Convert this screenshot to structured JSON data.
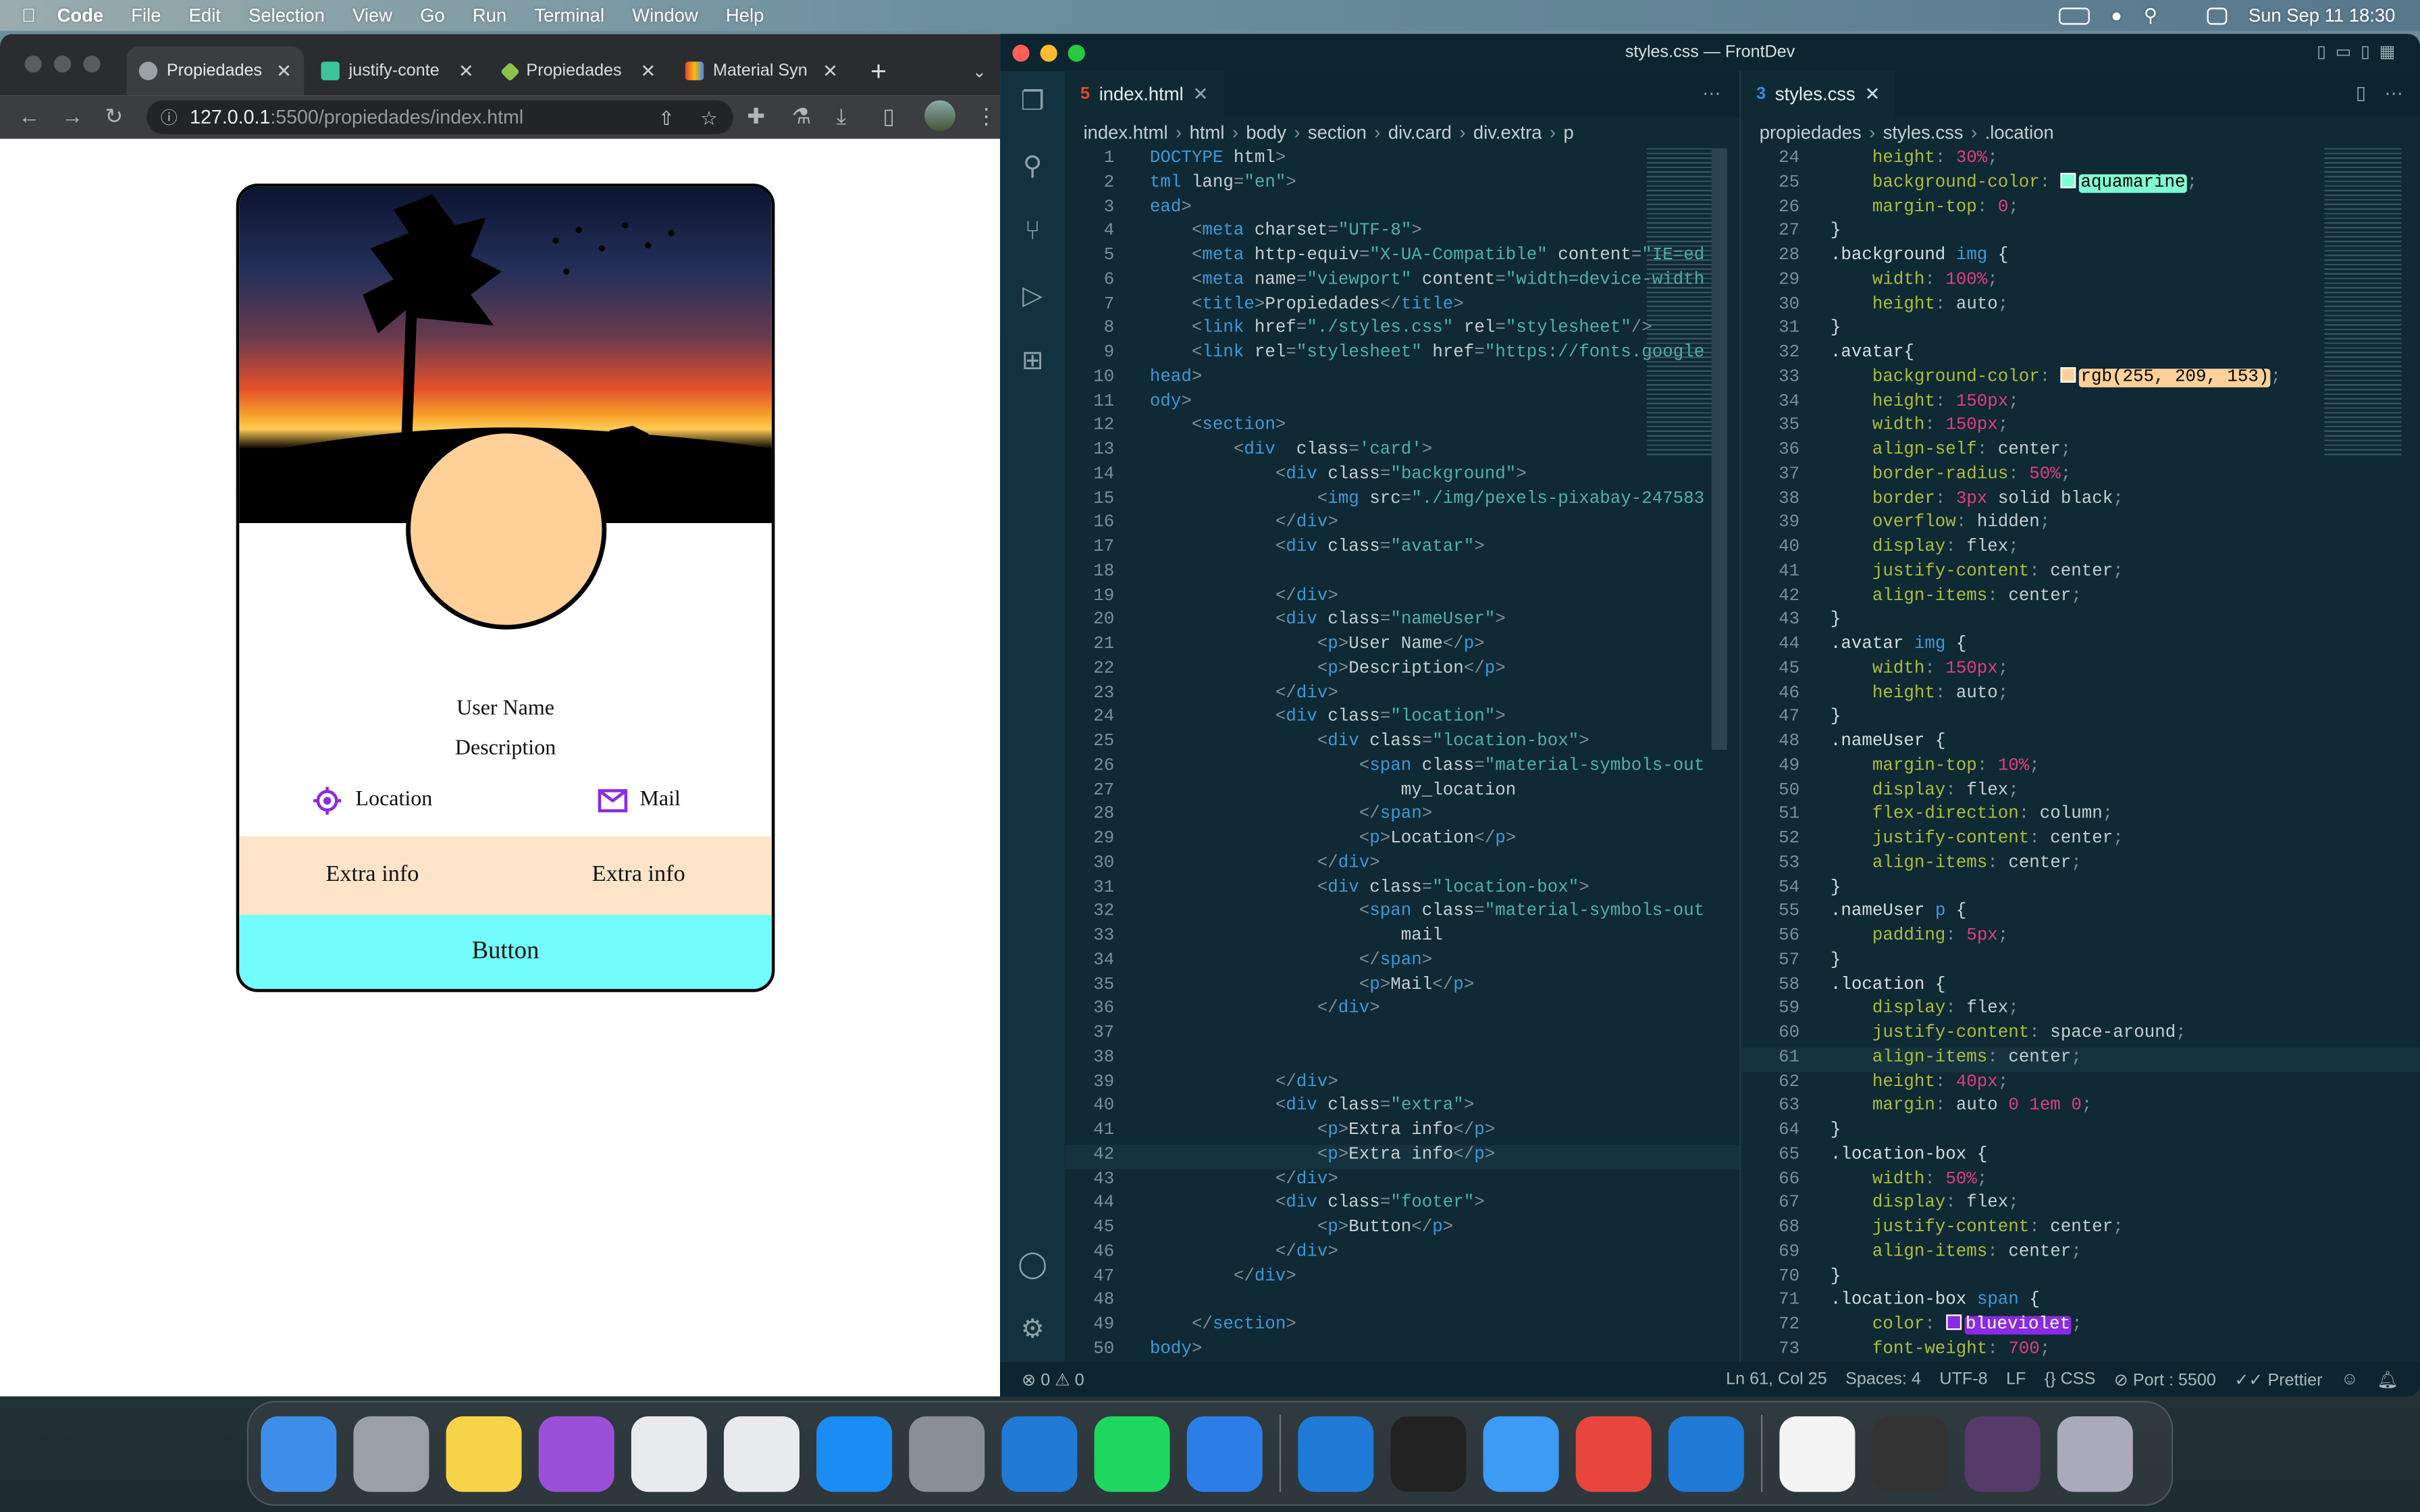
{
  "menubar": {
    "app": "Code",
    "items": [
      "File",
      "Edit",
      "Selection",
      "View",
      "Go",
      "Run",
      "Terminal",
      "Window",
      "Help"
    ],
    "clock": "Sun Sep 11  18:30"
  },
  "browser": {
    "tabs": [
      {
        "title": "Propiedades",
        "color": "#9aa0a6"
      },
      {
        "title": "justify-conte",
        "color": "#3cc49a"
      },
      {
        "title": "Propiedades",
        "color": "#8bc34a"
      },
      {
        "title": "Material Syn",
        "color": "#f4a81d"
      }
    ],
    "url_host": "127.0.0.1",
    "url_rest": ":5500/propiedades/index.html"
  },
  "card": {
    "user_name": "User Name",
    "description": "Description",
    "location_label": "Location",
    "mail_label": "Mail",
    "extra": [
      "Extra info",
      "Extra info"
    ],
    "button": "Button",
    "accent": "#8a2be2"
  },
  "vscode": {
    "title": "styles.css — FrontDev",
    "left_tab": "index.html",
    "right_tab": "styles.css",
    "left_crumbs": [
      "index.html",
      "html",
      "body",
      "section",
      "div.card",
      "div.extra",
      "p"
    ],
    "right_crumbs": [
      "propiedades",
      "styles.css",
      ".location"
    ],
    "html_start": 1,
    "html_lines": [
      "DOCTYPE html>",
      "tml lang=\"en\">",
      "ead>",
      "    <meta charset=\"UTF-8\">",
      "    <meta http-equiv=\"X-UA-Compatible\" content=\"IE=ed",
      "    <meta name=\"viewport\" content=\"width=device-width",
      "    <title>Propiedades</title>",
      "    <link href=\"./styles.css\" rel=\"stylesheet\"/>",
      "    <link rel=\"stylesheet\" href=\"https://fonts.google",
      "head>",
      "ody>",
      "    <section>",
      "        <div  class='card'>",
      "            <div class=\"background\">",
      "                <img src=\"./img/pexels-pixabay-247583",
      "            </div>",
      "            <div class=\"avatar\">",
      "",
      "            </div>",
      "            <div class=\"nameUser\">",
      "                <p>User Name</p>",
      "                <p>Description</p>",
      "            </div>",
      "            <div class=\"location\">",
      "                <div class=\"location-box\">",
      "                    <span class=\"material-symbols-out",
      "                        my_location",
      "                    </span>",
      "                    <p>Location</p>",
      "                </div>",
      "                <div class=\"location-box\">",
      "                    <span class=\"material-symbols-out",
      "                        mail",
      "                    </span>",
      "                    <p>Mail</p>",
      "                </div>",
      "",
      "",
      "            </div>",
      "            <div class=\"extra\">",
      "                <p>Extra info</p>",
      "                <p>Extra info</p>",
      "            </div>",
      "            <div class=\"footer\">",
      "                <p>Button</p>",
      "            </div>",
      "        </div>",
      "",
      "    </section>",
      "body>"
    ],
    "html_current": 42,
    "css_start": 24,
    "css_lines": [
      "    height: 30%;",
      "    background-color: aquamarine;",
      "    margin-top: 0;",
      "}",
      ".background img {",
      "    width: 100%;",
      "    height: auto;",
      "}",
      ".avatar{",
      "    background-color: rgb(255, 209, 153);",
      "    height: 150px;",
      "    width: 150px;",
      "    align-self: center;",
      "    border-radius: 50%;",
      "    border: 3px solid black;",
      "    overflow: hidden;",
      "    display: flex;",
      "    justify-content: center;",
      "    align-items: center;",
      "}",
      ".avatar img {",
      "    width: 150px;",
      "    height: auto;",
      "}",
      ".nameUser {",
      "    margin-top: 10%;",
      "    display: flex;",
      "    flex-direction: column;",
      "    justify-content: center;",
      "    align-items: center;",
      "}",
      ".nameUser p {",
      "    padding: 5px;",
      "}",
      ".location {",
      "    display: flex;",
      "    justify-content: space-around;",
      "    align-items: center;",
      "    height: 40px;",
      "    margin: auto 0 1em 0;",
      "}",
      ".location-box {",
      "    width: 50%;",
      "    display: flex;",
      "    justify-content: center;",
      "    align-items: center;",
      "}",
      ".location-box span {",
      "    color: blueviolet;",
      "    font-weight: 700;"
    ],
    "css_current": 61,
    "swatches": {
      "aquamarine": "#7fffd4",
      "rgb(255, 209, 153)": "#ffd199",
      "black": "#000000",
      "blueviolet": "#8a2be2"
    },
    "status": {
      "problems": "0",
      "warnings": "0",
      "position": "Ln 61, Col 25",
      "spaces": "Spaces: 4",
      "encoding": "UTF-8",
      "eol": "LF",
      "language": "CSS",
      "port": "Port : 5500",
      "formatter": "Prettier"
    }
  },
  "dock": [
    "finder-icon",
    "launchpad-icon",
    "notes-icon",
    "podcasts-icon",
    "chrome-dev-icon",
    "chrome-icon",
    "app-store-icon",
    "system-preferences-icon",
    "vscode-icon",
    "spotify-icon",
    "xcode-icon",
    "vscode-icon-2",
    "terminal-icon",
    "mail-icon",
    "anydesk-icon",
    "vscode-insiders-icon",
    "document-icon",
    "window-preview-icon",
    "window-preview-icon-2",
    "trash-icon"
  ]
}
